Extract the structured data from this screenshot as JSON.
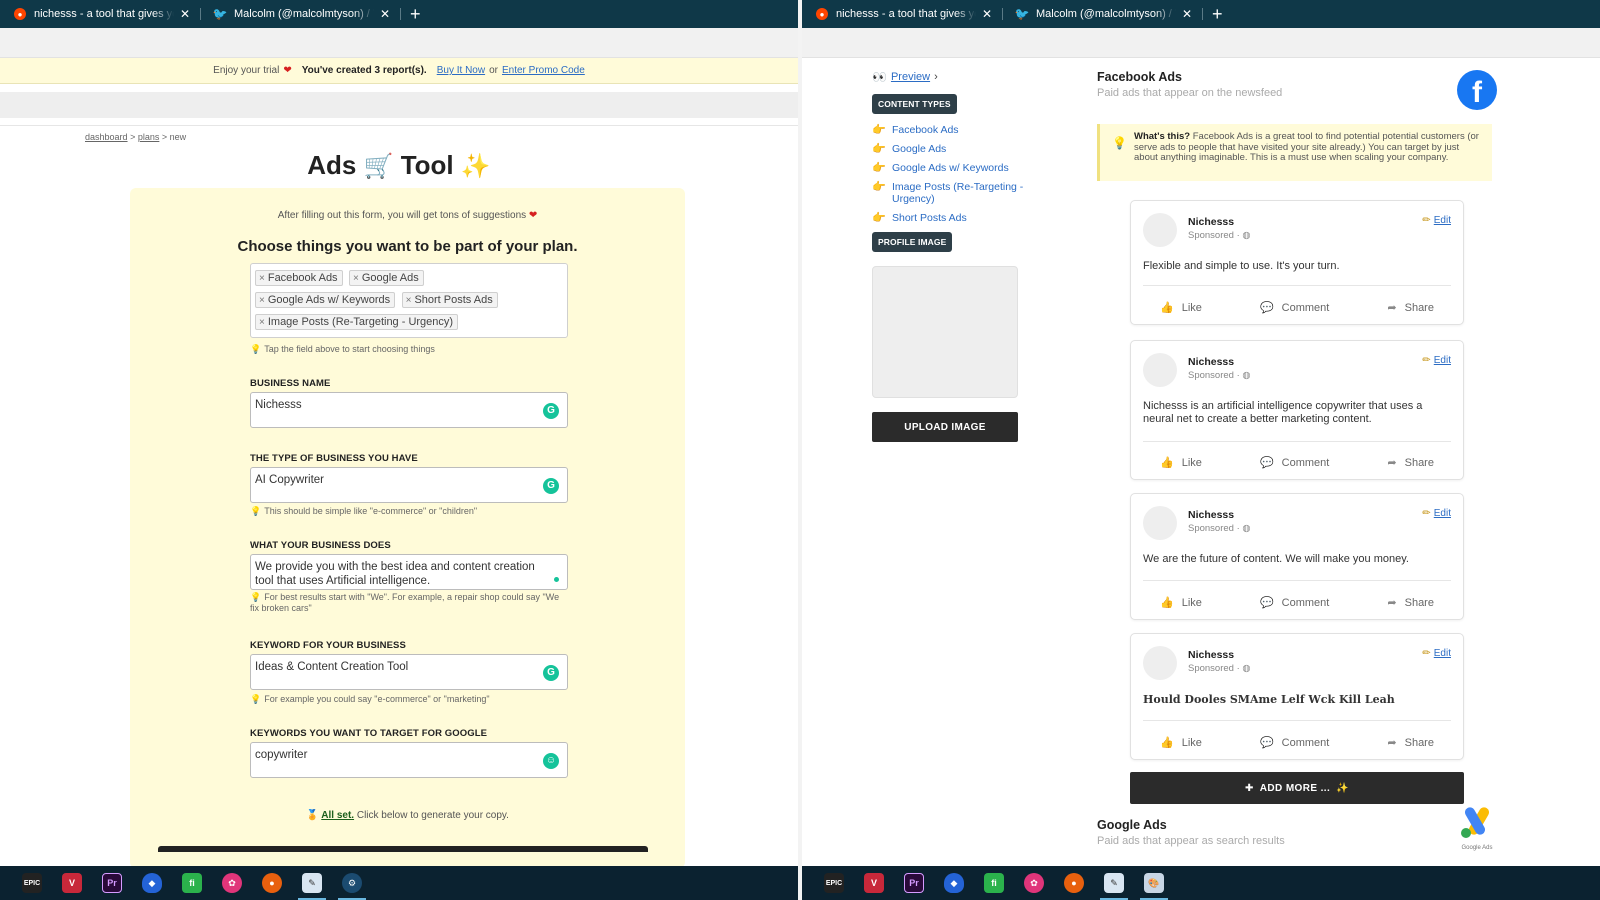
{
  "browser": {
    "tabs": [
      {
        "title": "nichesss - a tool that gives you b",
        "close": "✕"
      },
      {
        "title": "Malcolm (@malcolmtyson) / Twit",
        "close": "✕"
      }
    ],
    "new_tab": "+"
  },
  "trial_bar": {
    "text": "Enjoy your trial",
    "reports": "You've created 3 report(s).",
    "buy": "Buy It Now",
    "or": "or",
    "promo": "Enter Promo Code"
  },
  "breadcrumb": {
    "dashboard": "dashboard",
    "plans": "plans",
    "current": "new",
    "sep": ">"
  },
  "page_title": {
    "word1": "Ads",
    "emoji1": "🛒",
    "word2": "Tool",
    "emoji2": "✨"
  },
  "form": {
    "intro": "After filling out this form, you will get tons of suggestions",
    "choose_heading": "Choose things you want to be part of your plan.",
    "tags": [
      "Facebook Ads",
      "Google Ads",
      "Google Ads w/ Keywords",
      "Short Posts Ads",
      "Image Posts (Re-Targeting - Urgency)"
    ],
    "tag_hint": "Tap the field above to start choosing things",
    "business_name_label": "BUSINESS NAME",
    "business_name_value": "Nichesss",
    "business_type_label": "THE TYPE OF BUSINESS YOU HAVE",
    "business_type_value": "AI Copywriter",
    "business_type_hint": "This should be simple like \"e-commerce\" or \"children\"",
    "does_label": "WHAT YOUR BUSINESS DOES",
    "does_value": "We provide you with the best idea and content creation tool that uses Artificial intelligence.",
    "does_hint": "For best results start with \"We\". For example, a repair shop could say \"We fix broken cars\"",
    "keyword_label": "KEYWORD FOR YOUR BUSINESS",
    "keyword_value": "Ideas & Content Creation Tool",
    "keyword_hint": "For example you could say \"e-commerce\" or \"marketing\"",
    "google_kw_label": "KEYWORDS YOU WANT TO TARGET FOR GOOGLE",
    "google_kw_value": "copywriter",
    "all_set_link": "All set.",
    "all_set_text": "Click below to generate your copy."
  },
  "sidebar": {
    "preview": "Preview",
    "content_types_label": "CONTENT TYPES",
    "content_types": [
      "Facebook Ads",
      "Google Ads",
      "Google Ads w/ Keywords",
      "Image Posts (Re-Targeting - Urgency)",
      "Short Posts Ads"
    ],
    "profile_image_label": "PROFILE IMAGE",
    "upload_button": "UPLOAD IMAGE"
  },
  "facebook_section": {
    "title": "Facebook Ads",
    "subtitle": "Paid ads that appear on the newsfeed",
    "info_bold": "What's this?",
    "info_text": "Facebook Ads is a great tool to find potential potential customers (or serve ads to people that have visited your site already.) You can target by just about anything imaginable. This is a must use when scaling your company.",
    "posts": [
      {
        "name": "Nichesss",
        "sponsored": "Sponsored ·",
        "edit": "Edit",
        "body": "Flexible and simple to use. It's your turn."
      },
      {
        "name": "Nichesss",
        "sponsored": "Sponsored ·",
        "edit": "Edit",
        "body": "Nichesss is an artificial intelligence copywriter that uses a neural net to create a better marketing content."
      },
      {
        "name": "Nichesss",
        "sponsored": "Sponsored ·",
        "edit": "Edit",
        "body": "We are the future of content. We will make you money."
      },
      {
        "name": "Nichesss",
        "sponsored": "Sponsored ·",
        "edit": "Edit",
        "body": "Hould Dooles SMAme Lelf Wck Kill Leah"
      }
    ],
    "actions": {
      "like": "Like",
      "comment": "Comment",
      "share": "Share"
    },
    "add_more": "ADD MORE ..."
  },
  "google_section": {
    "title": "Google Ads",
    "subtitle": "Paid ads that appear as search results",
    "icon_caption": "Google Ads"
  },
  "taskbar": {
    "icons": [
      "epic-games",
      "vivaldi",
      "premiere-pro",
      "shield",
      "feedly",
      "flower-app",
      "firefox",
      "paint-app",
      "steam"
    ]
  },
  "colors": {
    "chrome": "#0f3848",
    "taskbar": "#0b2230",
    "cream": "#fffbd9",
    "link": "#2b6cc4",
    "facebook": "#1877f2",
    "grammarly": "#15c39a"
  }
}
